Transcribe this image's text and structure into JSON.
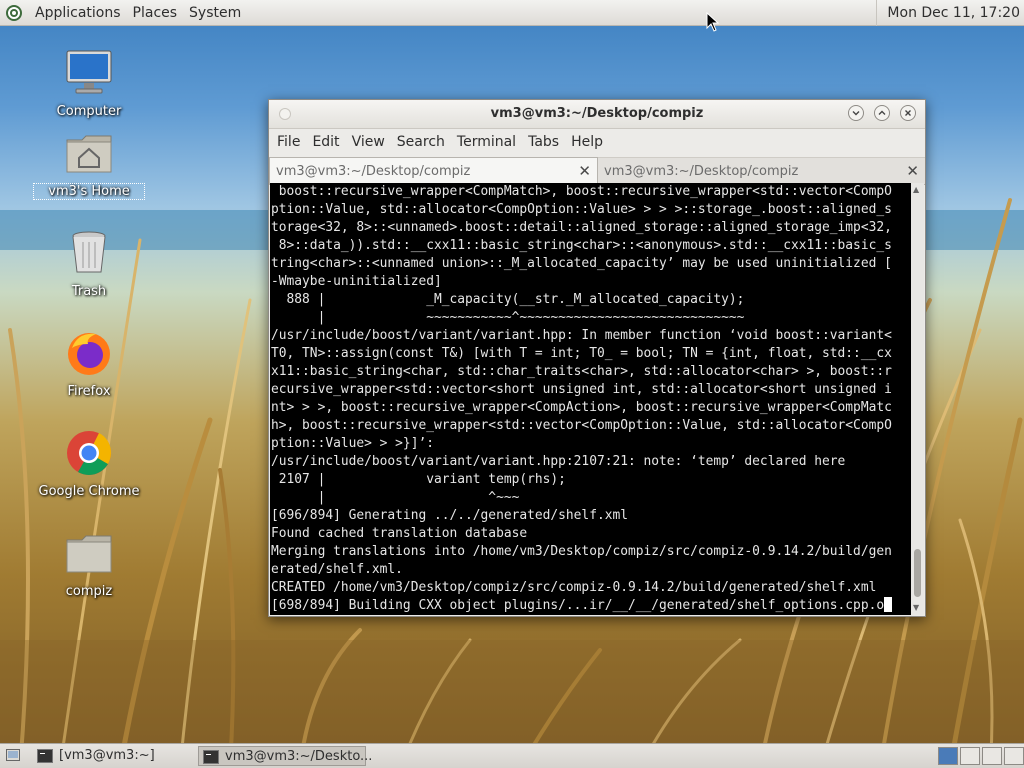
{
  "colors": {
    "panel": "#e4e2de",
    "terminal_bg": "#000000",
    "terminal_fg": "#e6e6e6"
  },
  "top_panel": {
    "menus": [
      "Applications",
      "Places",
      "System"
    ],
    "clock": "Mon Dec 11, 17:20"
  },
  "desktop": {
    "icons": [
      {
        "label": "Computer",
        "icon": "computer-icon"
      },
      {
        "label": "vm3's Home",
        "icon": "home-folder-icon"
      },
      {
        "label": "Trash",
        "icon": "trash-icon"
      },
      {
        "label": "Firefox",
        "icon": "firefox-icon"
      },
      {
        "label": "Google Chrome",
        "icon": "chrome-icon"
      },
      {
        "label": "compiz",
        "icon": "folder-icon"
      }
    ]
  },
  "window": {
    "title": "vm3@vm3:~/Desktop/compiz",
    "menu": [
      "File",
      "Edit",
      "View",
      "Search",
      "Terminal",
      "Tabs",
      "Help"
    ],
    "tabs": [
      {
        "label": "vm3@vm3:~/Desktop/compiz",
        "active": true
      },
      {
        "label": "vm3@vm3:~/Desktop/compiz",
        "active": false
      }
    ],
    "terminal_lines": [
      " boost::recursive_wrapper<CompMatch>, boost::recursive_wrapper<std::vector<CompO",
      "ption::Value, std::allocator<CompOption::Value> > > >::storage_.boost::aligned_s",
      "torage<32, 8>::<unnamed>.boost::detail::aligned_storage::aligned_storage_imp<32,",
      " 8>::data_)).std::__cxx11::basic_string<char>::<anonymous>.std::__cxx11::basic_s",
      "tring<char>::<unnamed union>::_M_allocated_capacity’ may be used uninitialized [",
      "-Wmaybe-uninitialized]",
      "  888 |             _M_capacity(__str._M_allocated_capacity);",
      "      |             ~~~~~~~~~~~^~~~~~~~~~~~~~~~~~~~~~~~~~~~~~",
      "/usr/include/boost/variant/variant.hpp: In member function ‘void boost::variant<",
      "T0, TN>::assign(const T&) [with T = int; T0_ = bool; TN = {int, float, std::__cx",
      "x11::basic_string<char, std::char_traits<char>, std::allocator<char> >, boost::r",
      "ecursive_wrapper<std::vector<short unsigned int, std::allocator<short unsigned i",
      "nt> > >, boost::recursive_wrapper<CompAction>, boost::recursive_wrapper<CompMatc",
      "h>, boost::recursive_wrapper<std::vector<CompOption::Value, std::allocator<CompO",
      "ption::Value> > >}]’:",
      "/usr/include/boost/variant/variant.hpp:2107:21: note: ‘temp’ declared here",
      " 2107 |             variant temp(rhs);",
      "      |                     ^~~~",
      "[696/894] Generating ../../generated/shelf.xml",
      "Found cached translation database",
      "Merging translations into /home/vm3/Desktop/compiz/src/compiz-0.9.14.2/build/gen",
      "erated/shelf.xml.",
      "CREATED /home/vm3/Desktop/compiz/src/compiz-0.9.14.2/build/generated/shelf.xml",
      "[698/894] Building CXX object plugins/...ir/__/__/generated/shelf_options.cpp.o"
    ]
  },
  "taskbar": {
    "tasks": [
      {
        "label": "[vm3@vm3:~]",
        "active": false
      },
      {
        "label": "vm3@vm3:~/Deskto...",
        "active": true
      }
    ]
  }
}
